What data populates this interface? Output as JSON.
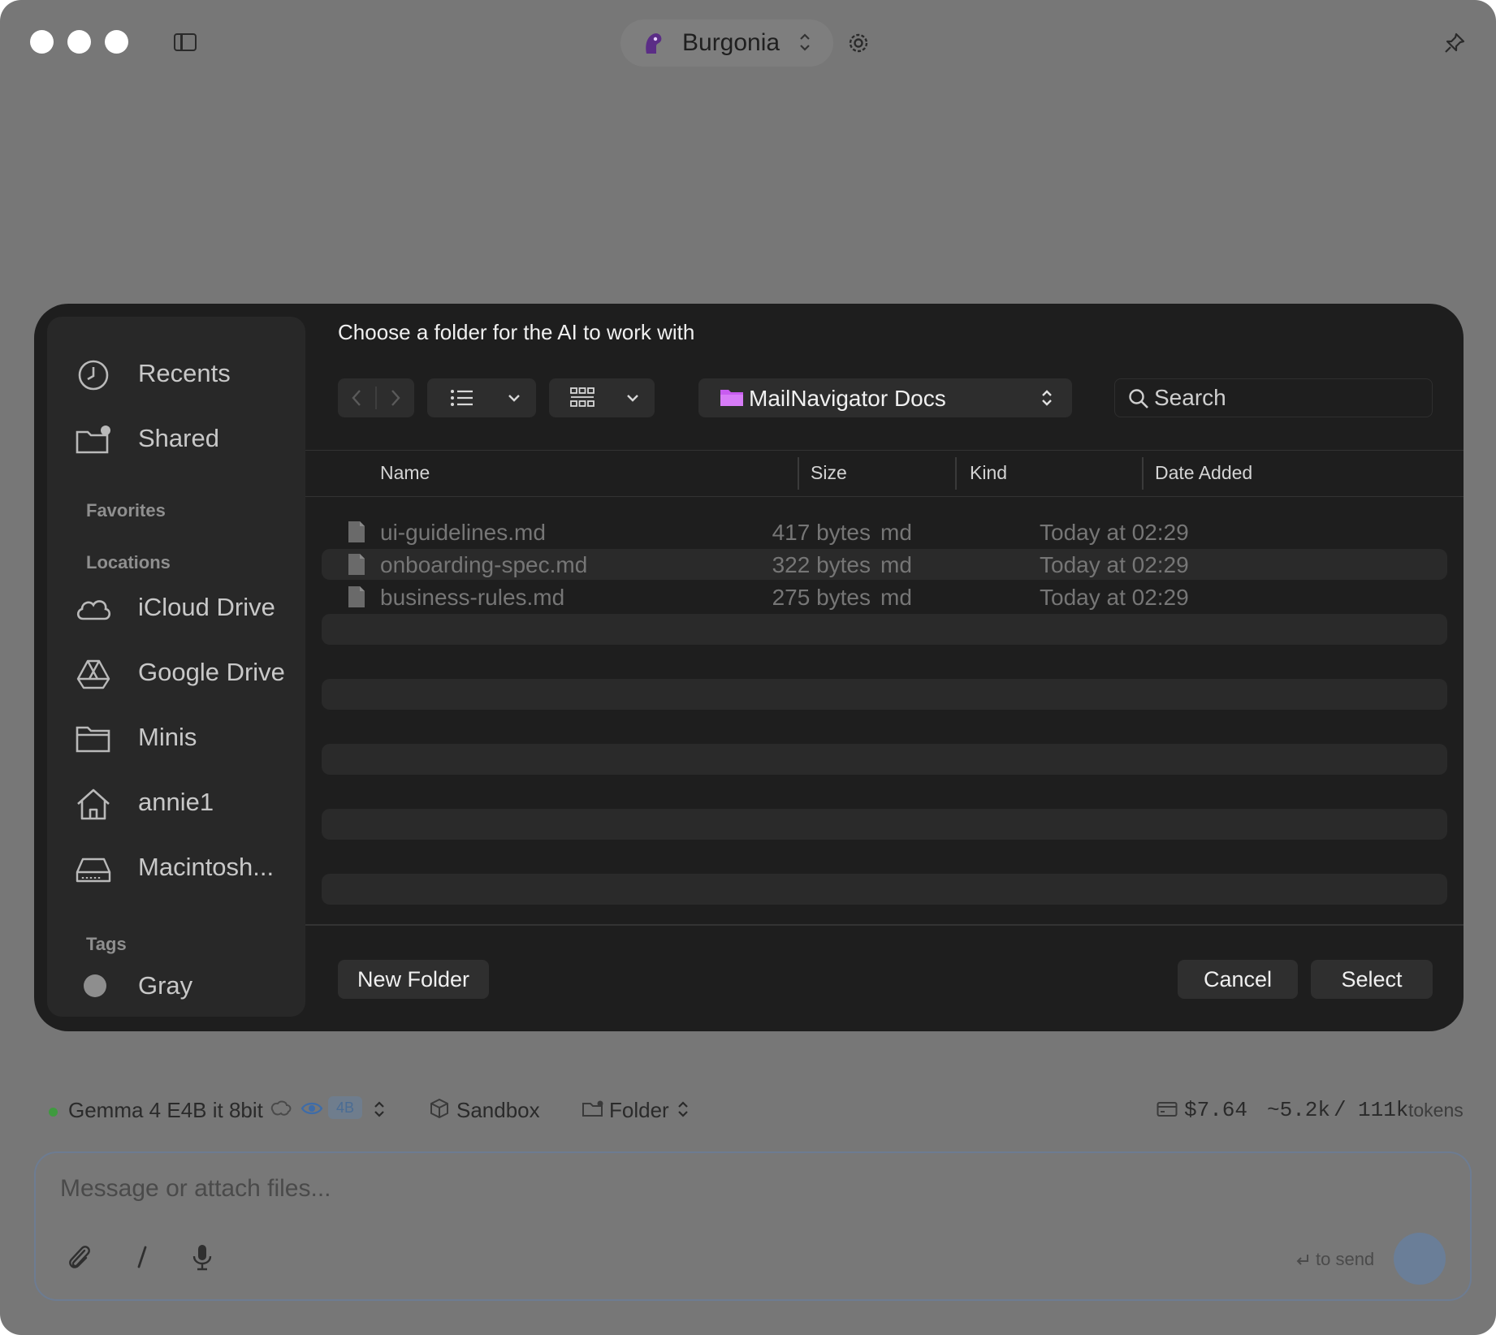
{
  "titlebar": {
    "app_name": "Burgonia"
  },
  "dialog": {
    "title": "Choose a folder for the AI to work with",
    "location": "MailNavigator Docs",
    "search_placeholder": "Search",
    "sidebar": {
      "items_top": [
        {
          "label": "Recents",
          "icon": "clock-icon"
        },
        {
          "label": "Shared",
          "icon": "shared-folder-icon"
        }
      ],
      "favorites_label": "Favorites",
      "locations_label": "Locations",
      "locations": [
        {
          "label": "iCloud Drive",
          "icon": "cloud-icon"
        },
        {
          "label": "Google Drive",
          "icon": "google-drive-icon"
        },
        {
          "label": "Minis",
          "icon": "folder-icon"
        },
        {
          "label": "annie1",
          "icon": "home-icon"
        },
        {
          "label": "Macintosh...",
          "icon": "hard-drive-icon"
        }
      ],
      "tags_label": "Tags",
      "tags": [
        {
          "label": "Gray",
          "color": "#8e8e8e"
        }
      ]
    },
    "columns": {
      "name": "Name",
      "size": "Size",
      "kind": "Kind",
      "date": "Date Added"
    },
    "files": [
      {
        "name": "ui-guidelines.md",
        "size": "417 bytes",
        "kind": "md",
        "date": "Today at 02:29"
      },
      {
        "name": "onboarding-spec.md",
        "size": "322 bytes",
        "kind": "md",
        "date": "Today at 02:29"
      },
      {
        "name": "business-rules.md",
        "size": "275 bytes",
        "kind": "md",
        "date": "Today at 02:29"
      }
    ],
    "buttons": {
      "new_folder": "New Folder",
      "cancel": "Cancel",
      "select": "Select"
    },
    "colors": {
      "folder": "#c85cf0",
      "background": "#1e1e1e"
    }
  },
  "status": {
    "model": "Gemma 4 E4B it 8bit",
    "model_badge": "4B",
    "sandbox": "Sandbox",
    "folder": "Folder",
    "cost": "$7.64",
    "tokens_used": "~5.2k",
    "tokens_sep": "/",
    "tokens_total": "111k",
    "tokens_label": "tokens"
  },
  "composer": {
    "placeholder": "Message or attach files...",
    "send_hint": "to send",
    "send_hint_icon": "return-key-icon"
  }
}
